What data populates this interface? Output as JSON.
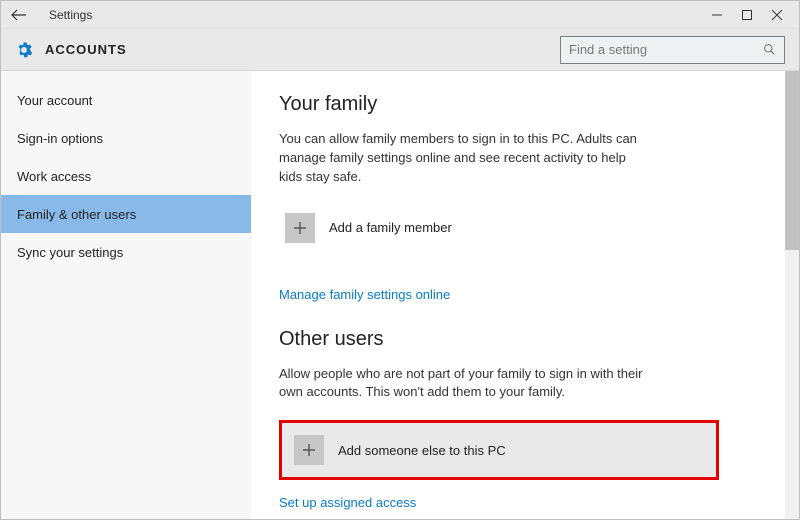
{
  "window": {
    "title": "Settings"
  },
  "header": {
    "section": "ACCOUNTS"
  },
  "search": {
    "placeholder": "Find a setting"
  },
  "sidebar": {
    "items": [
      {
        "label": "Your account"
      },
      {
        "label": "Sign-in options"
      },
      {
        "label": "Work access"
      },
      {
        "label": "Family & other users"
      },
      {
        "label": "Sync your settings"
      }
    ],
    "selected_index": 3
  },
  "content": {
    "family": {
      "heading": "Your family",
      "description": "You can allow family members to sign in to this PC. Adults can manage family settings online and see recent activity to help kids stay safe.",
      "add_label": "Add a family member",
      "manage_link": "Manage family settings online"
    },
    "other": {
      "heading": "Other users",
      "description": "Allow people who are not part of your family to sign in with their own accounts. This won't add them to your family.",
      "add_label": "Add someone else to this PC",
      "assigned_link": "Set up assigned access"
    }
  }
}
